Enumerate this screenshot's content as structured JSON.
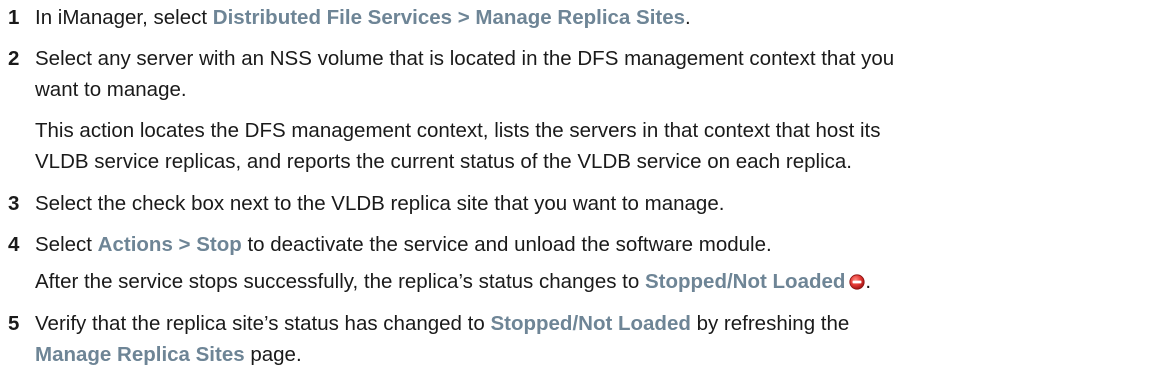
{
  "steps": [
    {
      "num": "1",
      "pre": "In iManager, select ",
      "ui": "Distributed File Services > Manage Replica Sites",
      "post": "."
    },
    {
      "num": "2",
      "line1": "Select any server with an NSS volume that is located in the DFS management context that you",
      "line2": "want to manage.",
      "note1": "This action locates the DFS management context, lists the servers in that context that host its",
      "note2": "VLDB service replicas, and reports the current status of the VLDB service on each replica."
    },
    {
      "num": "3",
      "text": "Select the check box next to the VLDB replica site that you want to manage."
    },
    {
      "num": "4",
      "pre": "Select ",
      "ui": "Actions > Stop",
      "post": " to deactivate the service and unload the software module.",
      "note_pre": "After the service stops successfully, the replica’s status changes to ",
      "note_ui": "Stopped/Not Loaded",
      "note_icon": "stop-status-icon",
      "note_post": "."
    },
    {
      "num": "5",
      "pre": "Verify that the replica site’s status has changed to ",
      "ui": "Stopped/Not Loaded",
      "post": " by refreshing the",
      "ui2": "Manage Replica Sites",
      "post2": " page."
    }
  ],
  "colors": {
    "text": "#1a1a1a",
    "ui_label": "#6e8596",
    "stop_icon": "#e0322e"
  }
}
